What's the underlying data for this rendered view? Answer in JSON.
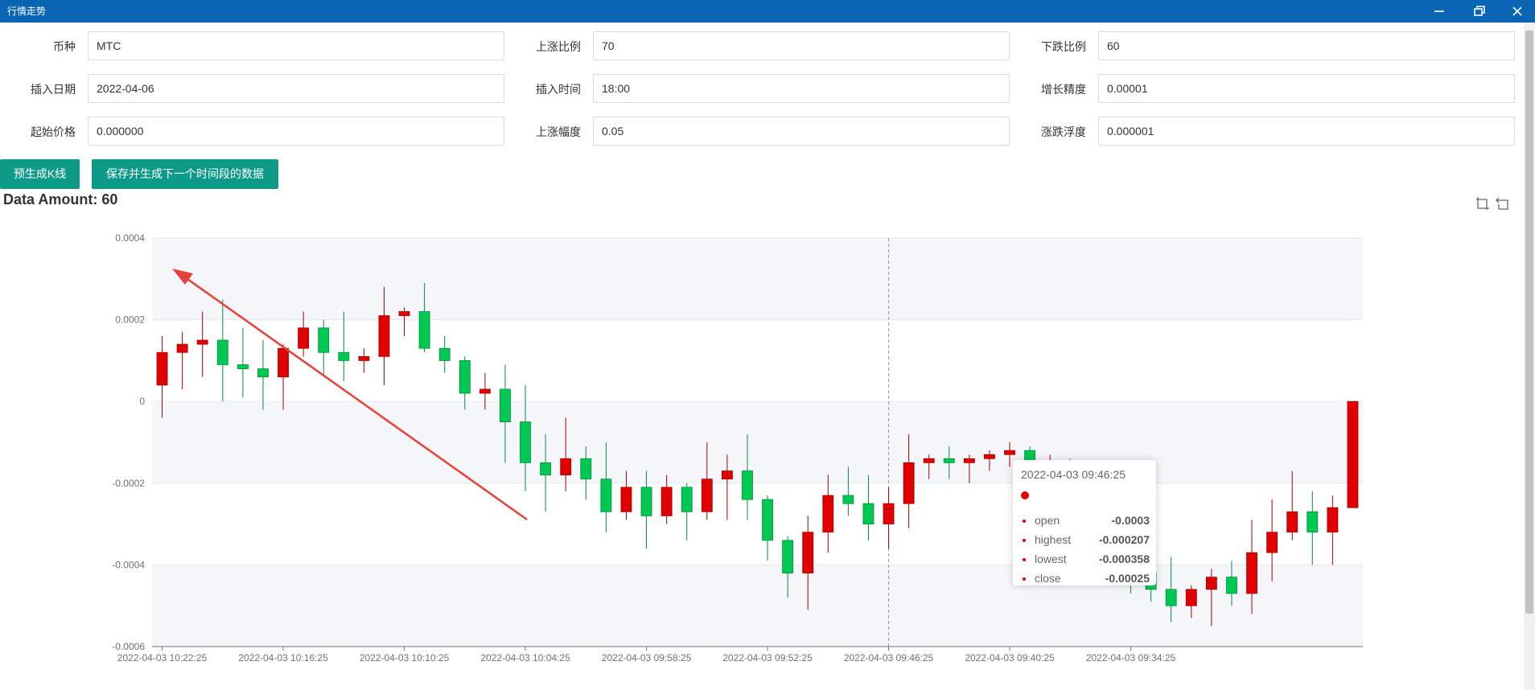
{
  "window": {
    "title": "行情走势",
    "minimize_icon": "minimize-icon",
    "restore_icon": "restore-icon",
    "close_icon": "close-icon"
  },
  "form": {
    "coin": {
      "label": "币种",
      "value": "MTC"
    },
    "rise_ratio": {
      "label": "上涨比例",
      "value": "70"
    },
    "fall_ratio": {
      "label": "下跌比例",
      "value": "60"
    },
    "insert_date": {
      "label": "插入日期",
      "value": "2022-04-06"
    },
    "insert_time": {
      "label": "插入时间",
      "value": "18:00"
    },
    "growth_precision": {
      "label": "增长精度",
      "value": "0.00001"
    },
    "start_price": {
      "label": "起始价格",
      "value": "0.000000"
    },
    "rise_amplitude": {
      "label": "上涨幅度",
      "value": "0.05"
    },
    "fluctuation": {
      "label": "涨跌浮度",
      "value": "0.000001"
    }
  },
  "buttons": {
    "pregenerate": "预生成K线",
    "save_next": "保存并生成下一个时间段的数据"
  },
  "data_amount": "Data Amount: 60",
  "toolbox": {
    "zoom_icon": "data-zoom-icon",
    "reset_icon": "zoom-reset-icon"
  },
  "tooltip": {
    "title": "2022-04-03 09:46:25",
    "rows": [
      {
        "name": "open",
        "value": "-0.0003"
      },
      {
        "name": "highest",
        "value": "-0.000207"
      },
      {
        "name": "lowest",
        "value": "-0.000358"
      },
      {
        "name": "close",
        "value": "-0.00025"
      }
    ]
  },
  "colors": {
    "up": "#e00000",
    "down": "#00c853",
    "titlebar": "#0a64b4",
    "button": "#0e9a89"
  },
  "chart_data": {
    "type": "candlestick",
    "title": "Data Amount: 60",
    "ylim": [
      -0.0006,
      0.0004
    ],
    "y_ticks": [
      "0.0004",
      "0.0002",
      "0",
      "-0.0002",
      "-0.0004",
      "-0.0006"
    ],
    "x_tick_labels": [
      "2022-04-03 10:22:25",
      "2022-04-03 10:16:25",
      "2022-04-03 10:10:25",
      "2022-04-03 10:04:25",
      "2022-04-03 09:58:25",
      "2022-04-03 09:52:25",
      "2022-04-03 09:46:25",
      "2022-04-03 09:40:25",
      "2022-04-03 09:34:25"
    ],
    "hovered_candle": "2022-04-03 09:46:25",
    "up_color": "#e00000",
    "down_color": "#00c853",
    "candles": [
      {
        "o": 4e-05,
        "c": 0.00012,
        "l": -4e-05,
        "h": 0.00016
      },
      {
        "o": 0.00012,
        "c": 0.00014,
        "l": 3e-05,
        "h": 0.00017
      },
      {
        "o": 0.00014,
        "c": 0.00015,
        "l": 6e-05,
        "h": 0.00022
      },
      {
        "o": 0.00015,
        "c": 9e-05,
        "l": 0.0,
        "h": 0.00025
      },
      {
        "o": 9e-05,
        "c": 8e-05,
        "l": 1e-05,
        "h": 0.00018
      },
      {
        "o": 8e-05,
        "c": 6e-05,
        "l": -2e-05,
        "h": 0.00015
      },
      {
        "o": 6e-05,
        "c": 0.00013,
        "l": -2e-05,
        "h": 0.00014
      },
      {
        "o": 0.00013,
        "c": 0.00018,
        "l": 0.00011,
        "h": 0.00022
      },
      {
        "o": 0.00018,
        "c": 0.00012,
        "l": 6e-05,
        "h": 0.0002
      },
      {
        "o": 0.00012,
        "c": 0.0001,
        "l": 5e-05,
        "h": 0.00022
      },
      {
        "o": 0.0001,
        "c": 0.00011,
        "l": 7e-05,
        "h": 0.00013
      },
      {
        "o": 0.00011,
        "c": 0.00021,
        "l": 4e-05,
        "h": 0.00028
      },
      {
        "o": 0.00021,
        "c": 0.00022,
        "l": 0.00016,
        "h": 0.00023
      },
      {
        "o": 0.00022,
        "c": 0.00013,
        "l": 0.00012,
        "h": 0.00029
      },
      {
        "o": 0.00013,
        "c": 0.0001,
        "l": 7e-05,
        "h": 0.00016
      },
      {
        "o": 0.0001,
        "c": 2e-05,
        "l": -2e-05,
        "h": 0.00011
      },
      {
        "o": 2e-05,
        "c": 3e-05,
        "l": -2e-05,
        "h": 7e-05
      },
      {
        "o": 3e-05,
        "c": -5e-05,
        "l": -0.00015,
        "h": 9e-05
      },
      {
        "o": -5e-05,
        "c": -0.00015,
        "l": -0.00022,
        "h": 4e-05
      },
      {
        "o": -0.00015,
        "c": -0.00018,
        "l": -0.00027,
        "h": -8e-05
      },
      {
        "o": -0.00018,
        "c": -0.00014,
        "l": -0.00022,
        "h": -4e-05
      },
      {
        "o": -0.00014,
        "c": -0.00019,
        "l": -0.00024,
        "h": -0.00011
      },
      {
        "o": -0.00019,
        "c": -0.00027,
        "l": -0.00032,
        "h": -0.0001
      },
      {
        "o": -0.00027,
        "c": -0.00021,
        "l": -0.00029,
        "h": -0.00017
      },
      {
        "o": -0.00021,
        "c": -0.00028,
        "l": -0.00036,
        "h": -0.00017
      },
      {
        "o": -0.00028,
        "c": -0.00021,
        "l": -0.0003,
        "h": -0.00018
      },
      {
        "o": -0.00021,
        "c": -0.00027,
        "l": -0.00034,
        "h": -0.0002
      },
      {
        "o": -0.00027,
        "c": -0.00019,
        "l": -0.00029,
        "h": -0.0001
      },
      {
        "o": -0.00019,
        "c": -0.00017,
        "l": -0.00029,
        "h": -0.00013
      },
      {
        "o": -0.00017,
        "c": -0.00024,
        "l": -0.00029,
        "h": -8e-05
      },
      {
        "o": -0.00024,
        "c": -0.00034,
        "l": -0.00039,
        "h": -0.00023
      },
      {
        "o": -0.00034,
        "c": -0.00042,
        "l": -0.00048,
        "h": -0.00033
      },
      {
        "o": -0.00042,
        "c": -0.00032,
        "l": -0.00051,
        "h": -0.00028
      },
      {
        "o": -0.00032,
        "c": -0.00023,
        "l": -0.00037,
        "h": -0.00018
      },
      {
        "o": -0.00023,
        "c": -0.00025,
        "l": -0.00028,
        "h": -0.00016
      },
      {
        "o": -0.00025,
        "c": -0.0003,
        "l": -0.00034,
        "h": -0.00018
      },
      {
        "o": -0.0003,
        "c": -0.00025,
        "l": -0.00036,
        "h": -0.00021
      },
      {
        "o": -0.00025,
        "c": -0.00015,
        "l": -0.00031,
        "h": -8e-05
      },
      {
        "o": -0.00015,
        "c": -0.00014,
        "l": -0.00019,
        "h": -0.00013
      },
      {
        "o": -0.00014,
        "c": -0.00015,
        "l": -0.00019,
        "h": -0.00011
      },
      {
        "o": -0.00015,
        "c": -0.00014,
        "l": -0.0002,
        "h": -0.00013
      },
      {
        "o": -0.00014,
        "c": -0.00013,
        "l": -0.00017,
        "h": -0.00012
      },
      {
        "o": -0.00013,
        "c": -0.00012,
        "l": -0.00016,
        "h": -0.0001
      },
      {
        "o": -0.00012,
        "c": -0.00016,
        "l": -0.0002,
        "h": -0.00011
      },
      {
        "o": -0.00016,
        "c": -0.00015,
        "l": -0.00019,
        "h": -0.00013
      },
      {
        "o": -0.00015,
        "c": -0.00018,
        "l": -0.00021,
        "h": -0.00014
      },
      {
        "o": -0.00018,
        "c": -0.00017,
        "l": -0.00021,
        "h": -0.00015
      },
      {
        "o": -0.00017,
        "c": -0.0002,
        "l": -0.00023,
        "h": -0.00016
      },
      {
        "o": -0.0002,
        "c": -0.00042,
        "l": -0.00047,
        "h": -0.00017
      },
      {
        "o": -0.00042,
        "c": -0.00046,
        "l": -0.00049,
        "h": -0.00037
      },
      {
        "o": -0.00046,
        "c": -0.0005,
        "l": -0.00054,
        "h": -0.00038
      },
      {
        "o": -0.0005,
        "c": -0.00046,
        "l": -0.00053,
        "h": -0.00045
      },
      {
        "o": -0.00046,
        "c": -0.00043,
        "l": -0.00055,
        "h": -0.00041
      },
      {
        "o": -0.00043,
        "c": -0.00047,
        "l": -0.0005,
        "h": -0.00039
      },
      {
        "o": -0.00047,
        "c": -0.00037,
        "l": -0.00052,
        "h": -0.00029
      },
      {
        "o": -0.00037,
        "c": -0.00032,
        "l": -0.00044,
        "h": -0.00024
      },
      {
        "o": -0.00032,
        "c": -0.00027,
        "l": -0.00034,
        "h": -0.00017
      },
      {
        "o": -0.00027,
        "c": -0.00032,
        "l": -0.0004,
        "h": -0.00022
      },
      {
        "o": -0.00032,
        "c": -0.00026,
        "l": -0.0004,
        "h": -0.00023
      },
      {
        "o": -0.00026,
        "c": 0.0,
        "l": -0.00026,
        "h": 0.0
      }
    ]
  }
}
